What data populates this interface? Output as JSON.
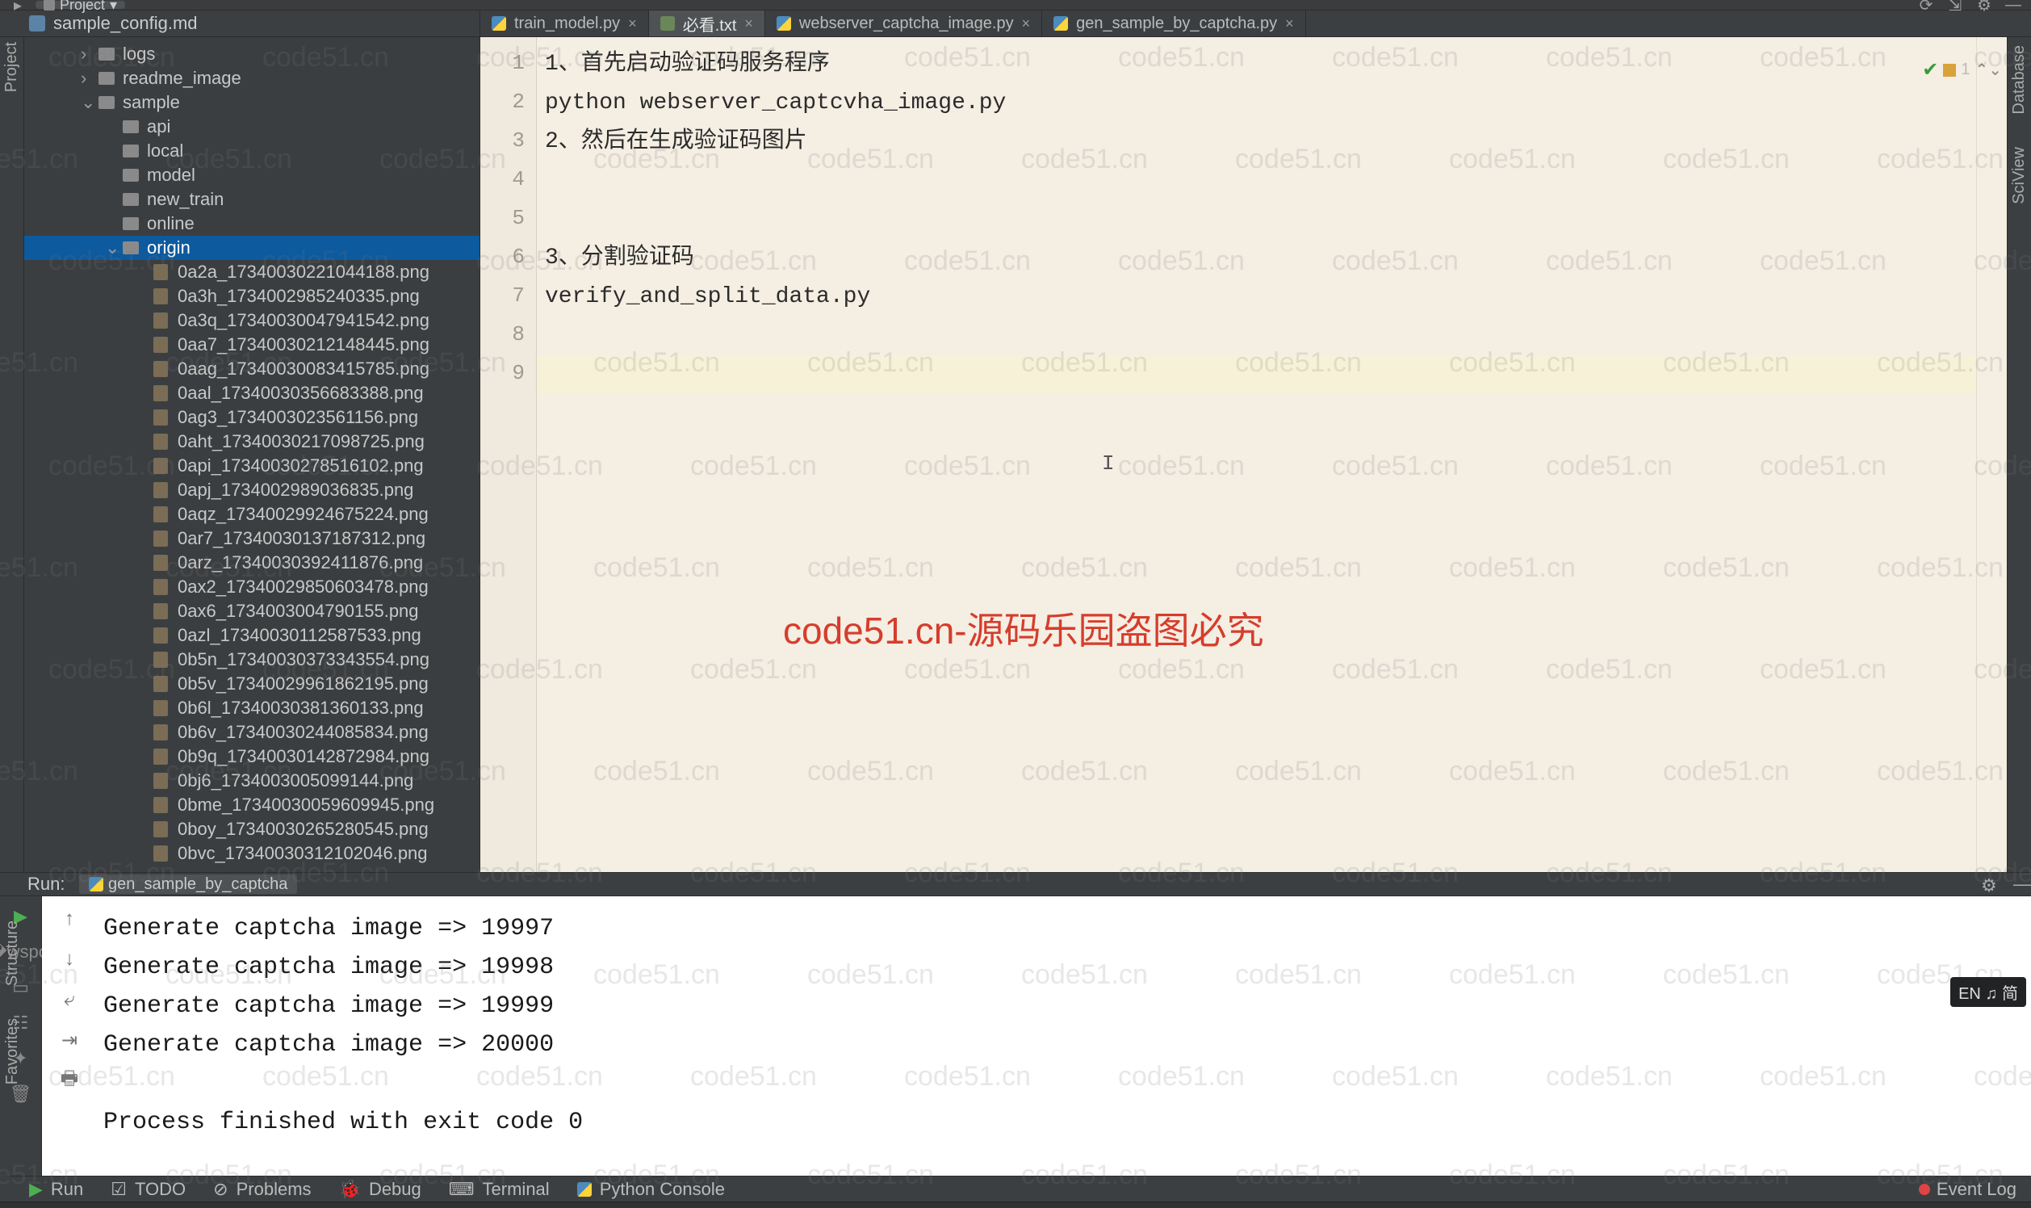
{
  "topbar": {
    "project_chip": "Project"
  },
  "project_header": {
    "file": "sample_config.md"
  },
  "editor_tabs": [
    {
      "name": "train_model.py",
      "kind": "py",
      "active": false
    },
    {
      "name": "必看.txt",
      "kind": "txt",
      "active": true
    },
    {
      "name": "webserver_captcha_image.py",
      "kind": "py",
      "active": false
    },
    {
      "name": "gen_sample_by_captcha.py",
      "kind": "py",
      "active": false
    }
  ],
  "tree": {
    "folders": [
      {
        "name": "logs",
        "depth": 1,
        "expand": ">"
      },
      {
        "name": "readme_image",
        "depth": 1,
        "expand": ">"
      },
      {
        "name": "sample",
        "depth": 1,
        "expand": "v"
      },
      {
        "name": "api",
        "depth": 2,
        "expand": ""
      },
      {
        "name": "local",
        "depth": 2,
        "expand": ""
      },
      {
        "name": "model",
        "depth": 2,
        "expand": ""
      },
      {
        "name": "new_train",
        "depth": 2,
        "expand": ""
      },
      {
        "name": "online",
        "depth": 2,
        "expand": ""
      },
      {
        "name": "origin",
        "depth": 2,
        "expand": "v",
        "selected": true
      }
    ],
    "files": [
      "0a2a_17340030221044188.png",
      "0a3h_1734002985240335.png",
      "0a3q_17340030047941542.png",
      "0aa7_17340030212148445.png",
      "0aag_17340030083415785.png",
      "0aal_17340030356683388.png",
      "0ag3_1734003023561156.png",
      "0aht_17340030217098725.png",
      "0api_17340030278516102.png",
      "0apj_1734002989036835.png",
      "0aqz_17340029924675224.png",
      "0ar7_17340030137187312.png",
      "0arz_17340030392411876.png",
      "0ax2_17340029850603478.png",
      "0ax6_1734003004790155.png",
      "0azl_17340030112587533.png",
      "0b5n_17340030373343554.png",
      "0b5v_17340029961862195.png",
      "0b6l_17340030381360133.png",
      "0b6v_17340030244085834.png",
      "0b9q_17340030142872984.png",
      "0bj6_1734003005099144.png",
      "0bme_17340030059609945.png",
      "0boy_17340030265280545.png",
      "0bvc_17340030312102046.png"
    ]
  },
  "editor": {
    "gutter": [
      "1",
      "2",
      "3",
      "4",
      "5",
      "6",
      "7",
      "8",
      "9"
    ],
    "lines": [
      "1、首先启动验证码服务程序",
      "python webserver_captcvha_image.py",
      "2、然后在生成验证码图片",
      "",
      "",
      "3、分割验证码",
      "verify_and_split_data.py",
      "",
      ""
    ],
    "current_line_index": 8,
    "analysis": {
      "warn_count": "1"
    }
  },
  "run": {
    "label": "Run:",
    "config": "gen_sample_by_captcha",
    "lines": [
      "Generate captcha image => 19997",
      "Generate captcha image => 19998",
      "Generate captcha image => 19999",
      "Generate captcha image => 20000",
      "",
      "Process finished with exit code 0"
    ]
  },
  "tool_strip": {
    "run": "Run",
    "todo": "TODO",
    "problems": "Problems",
    "debug": "Debug",
    "terminal": "Terminal",
    "pyconsole": "Python Console",
    "event_log": "Event Log"
  },
  "status": {
    "right": ""
  },
  "side_left": {
    "project": "Project",
    "structure": "Structure",
    "favorites": "Favorites"
  },
  "side_right": {
    "database": "Database",
    "sciview": "SciView"
  },
  "lang_badge": "EN ♫ 简",
  "watermark_center": "code51.cn-源码乐园盗图必究",
  "wm_text": "code51.cn"
}
